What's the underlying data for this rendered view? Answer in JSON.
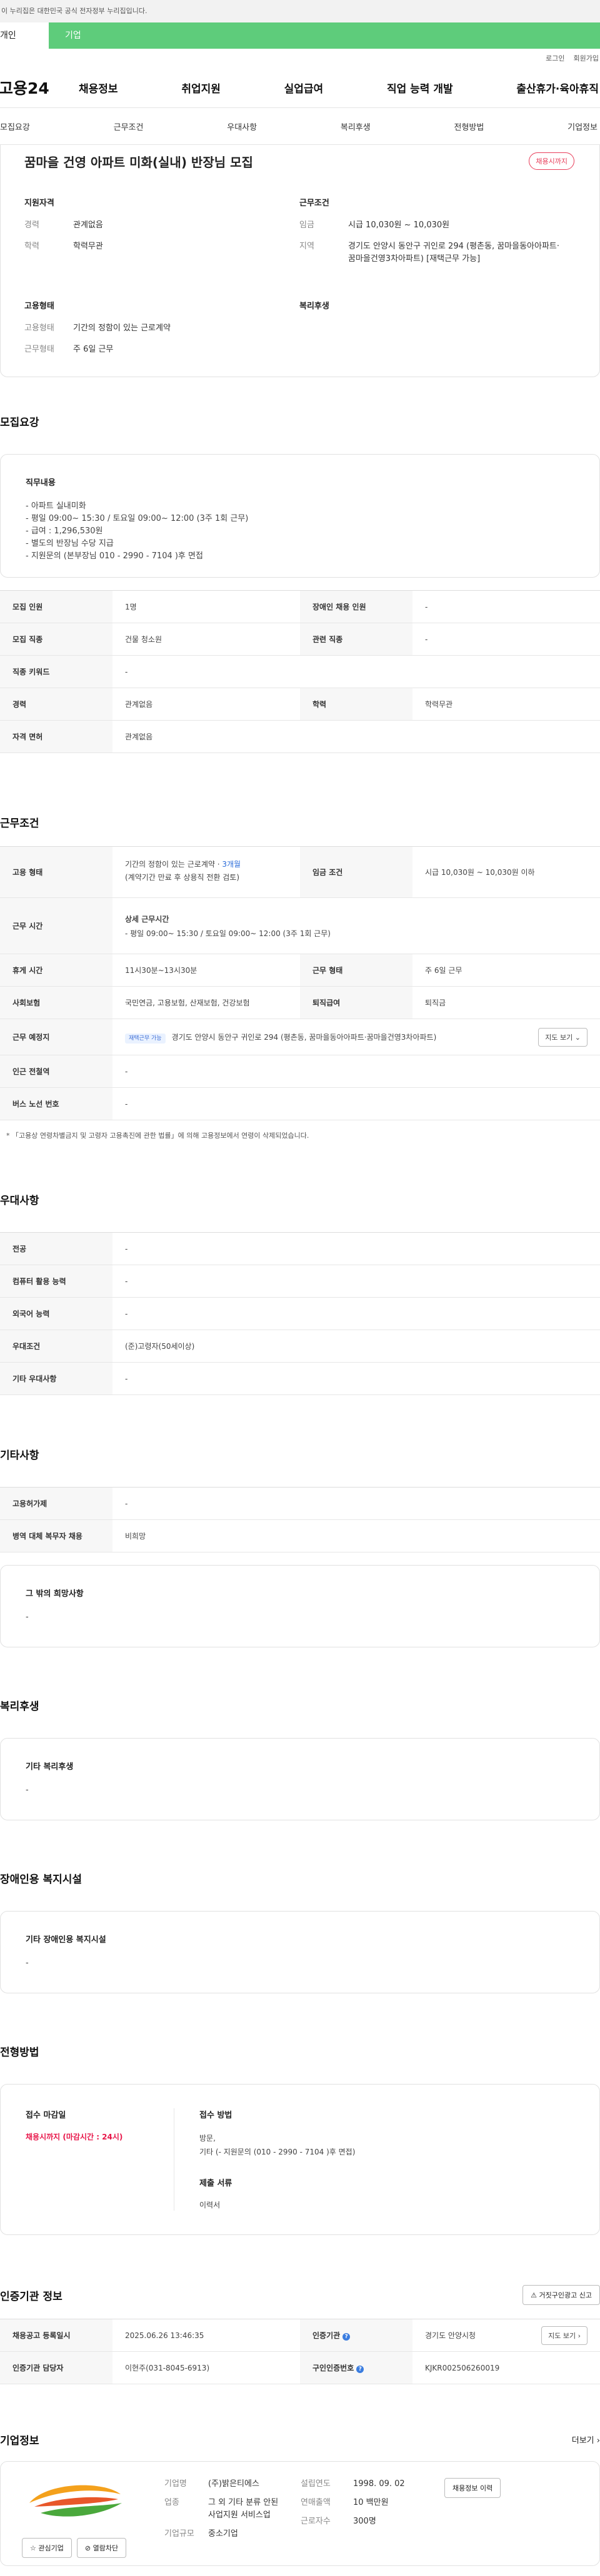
{
  "gov_notice": "이 누리집은 대한민국 공식 전자정부 누리집입니다.",
  "top_tabs": {
    "personal": "개인",
    "company": "기업"
  },
  "util": {
    "login": "로그인",
    "join": "회원가입"
  },
  "logo": "고용24",
  "gnb": [
    "채용정보",
    "취업지원",
    "실업급여",
    "직업 능력 개발",
    "출산휴가·육아휴직"
  ],
  "anchor_nav": [
    "모집요강",
    "근무조건",
    "우대사항",
    "복리후생",
    "전형방법",
    "기업정보"
  ],
  "summary": {
    "title": "꿈마을 건영 아파트 미화(실내) 반장님 모집",
    "badge": "채용시까지",
    "qualification": {
      "heading": "지원자격",
      "career_k": "경력",
      "career_v": "관계없음",
      "edu_k": "학력",
      "edu_v": "학력무관"
    },
    "conditions": {
      "heading": "근무조건",
      "wage_k": "임금",
      "wage_v": "시급 10,030원 ~ 10,030원",
      "loc_k": "지역",
      "loc_v": "경기도 안양시 동안구 귀인로 294 (평촌동, 꿈마을동아아파트·꿈마을건영3차아파트) [재택근무 가능]"
    },
    "employment": {
      "heading": "고용형태",
      "type_k": "고용형태",
      "type_v": "기간의 정함이 있는 근로계약",
      "work_k": "근무형태",
      "work_v": "주 6일 근무"
    },
    "welfare": {
      "heading": "복리후생"
    }
  },
  "recruit": {
    "title": "모집요강",
    "job_heading": "직무내용",
    "job_desc": "- 아파트 실내미화\n- 평일 09:00~ 15:30 / 토요일 09:00~ 12:00 (3주 1회 근무)\n- 급여 : 1,296,530원\n- 별도의 반장님 수당 지급\n- 지원문의 (본부장님 010 - 2990 - 7104 )후 면접",
    "rows": [
      [
        "모집 인원",
        "1명",
        "장애인 채용 인원",
        "-"
      ],
      [
        "모집 직종",
        "건물 청소원",
        "관련 직종",
        "-"
      ],
      [
        "직종 키워드",
        "-"
      ],
      [
        "경력",
        "관계없음",
        "학력",
        "학력무관"
      ],
      [
        "자격 면허",
        "관계없음"
      ]
    ]
  },
  "work": {
    "title": "근무조건",
    "emp_k": "고용 형태",
    "emp_v1": "기간의 정함이 있는 근로계약 · ",
    "emp_v1b": "3개월",
    "emp_v2": "(계약기간 만료 후 상용직 전환 검토)",
    "wage_k": "임금 조건",
    "wage_v": "시급 10,030원 ~ 10,030원 이하",
    "time_k": "근무 시간",
    "time_h": "상세 근무시간",
    "time_v": "- 평일 09:00~ 15:30 / 토요일 09:00~ 12:00 (3주 1회 근무)",
    "rest_k": "휴게 시간",
    "rest_v": "11시30분~13시30분",
    "form_k": "근무 형태",
    "form_v": "주 6일 근무",
    "ins_k": "사회보험",
    "ins_v": "국민연금, 고용보험, 산재보험, 건강보험",
    "ret_k": "퇴직급여",
    "ret_v": "퇴직금",
    "place_k": "근무 예정지",
    "place_tag": "재택근무 가능",
    "place_v": "경기도 안양시 동안구 귀인로 294 (평촌동, 꿈마을동아아파트·꿈마을건영3차아파트)",
    "map": "지도 보기",
    "sub_k": "인근 전철역",
    "sub_v": "-",
    "bus_k": "버스 노선 번호",
    "bus_v": "-",
    "note": "* 「고용상 연령차별금지 및 고령자 고용촉진에 관한 법률」에 의해 고용정보에서 연령이 삭제되었습니다."
  },
  "pref": {
    "title": "우대사항",
    "rows": [
      [
        "전공",
        "-"
      ],
      [
        "컴퓨터 활용 능력",
        "-"
      ],
      [
        "외국어 능력",
        "-"
      ],
      [
        "우대조건",
        "(준)고령자(50세이상)"
      ],
      [
        "기타 우대사항",
        "-"
      ]
    ]
  },
  "etc": {
    "title": "기타사항",
    "rows": [
      [
        "고용허가제",
        "-"
      ],
      [
        "병역 대체 복무자 채용",
        "비희망"
      ]
    ],
    "box_h": "그 밖의 희망사항",
    "box_v": "-"
  },
  "welfare": {
    "title": "복리후생",
    "box_h": "기타 복리후생",
    "box_v": "-"
  },
  "disabled": {
    "title": "장애인용 복지시설",
    "box_h": "기타 장애인용 복지시설",
    "box_v": "-"
  },
  "screening": {
    "title": "전형방법",
    "deadline_h": "접수 마감일",
    "deadline_v": "채용시까지 (마감시간 : 24시)",
    "method_h": "접수 방법",
    "method_v1": "방문,",
    "method_v2": "기타 (- 지원문의 (010 - 2990 - 7104 )후 면접)",
    "docs_h": "제출 서류",
    "docs_v": "이력서"
  },
  "cert": {
    "title": "인증기관 정보",
    "report": "거짓구인광고 신고",
    "reg_k": "채용공고 등록일시",
    "reg_v": "2025.06.26 13:46:35",
    "org_k": "인증기관",
    "org_v": "경기도 안양시청",
    "map": "지도 보기",
    "mgr_k": "인증기관 담당자",
    "mgr_v": "이현주(031-8045-6913)",
    "num_k": "구인인증번호",
    "num_v": "KJKR002506260019"
  },
  "company": {
    "title": "기업정보",
    "more": "더보기",
    "name_k": "기업명",
    "name_v": "(주)밝은티에스",
    "ind_k": "업종",
    "ind_v": "그 외 기타 분류 안된 사업지원 서비스업",
    "size_k": "기업규모",
    "size_v": "중소기업",
    "year_k": "설립연도",
    "year_v": "1998. 09. 02",
    "sales_k": "연매출액",
    "sales_v": "10 백만원",
    "emp_k": "근로자수",
    "emp_v": "300명",
    "hist_btn": "채용정보 이력",
    "fav_btn": "관심기업",
    "block_btn": "열람차단"
  }
}
